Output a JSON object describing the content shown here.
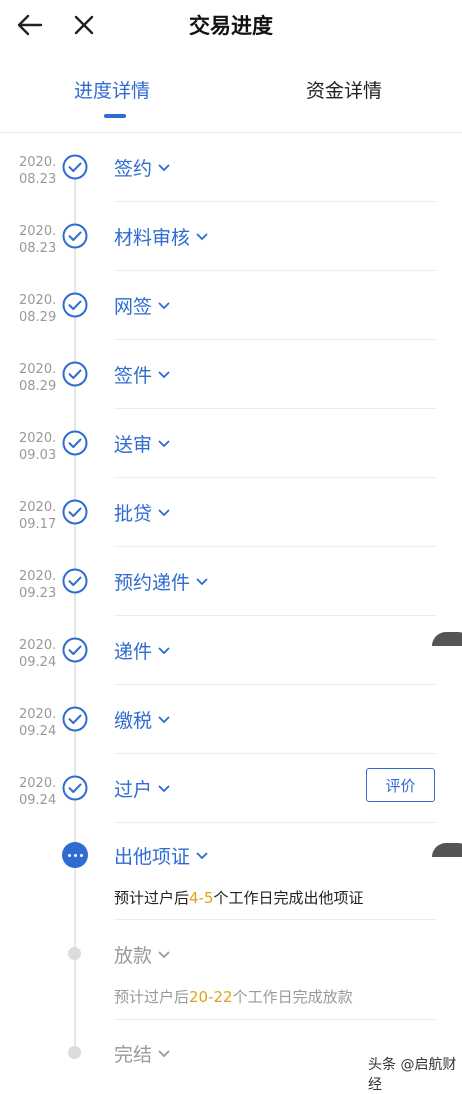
{
  "header": {
    "title": "交易进度"
  },
  "tabs": [
    {
      "label": "进度详情",
      "active": true
    },
    {
      "label": "资金详情",
      "active": false
    }
  ],
  "steps": [
    {
      "date_year": "2020.",
      "date_day": "08.23",
      "label": "签约"
    },
    {
      "date_year": "2020.",
      "date_day": "08.23",
      "label": "材料审核"
    },
    {
      "date_year": "2020.",
      "date_day": "08.29",
      "label": "网签"
    },
    {
      "date_year": "2020.",
      "date_day": "08.29",
      "label": "签件"
    },
    {
      "date_year": "2020.",
      "date_day": "09.03",
      "label": "送审"
    },
    {
      "date_year": "2020.",
      "date_day": "09.17",
      "label": "批贷"
    },
    {
      "date_year": "2020.",
      "date_day": "09.23",
      "label": "预约递件"
    },
    {
      "date_year": "2020.",
      "date_day": "09.24",
      "label": "递件"
    },
    {
      "date_year": "2020.",
      "date_day": "09.24",
      "label": "缴税"
    },
    {
      "date_year": "2020.",
      "date_day": "09.24",
      "label": "过户"
    }
  ],
  "evaluate_label": "评价",
  "current": {
    "label": "出他项证",
    "desc_prefix": "预计过户后",
    "desc_highlight": "4-5",
    "desc_suffix": "个工作日完成出他项证"
  },
  "upcoming": [
    {
      "label": "放款",
      "desc_prefix": "预计过户后",
      "desc_highlight": "20-22",
      "desc_suffix": "个工作日完成放款"
    },
    {
      "label": "完结"
    }
  ],
  "watermark": "头条 @启航财经",
  "colors": {
    "accent": "#2f6bd0",
    "highlight": "#e0a21a",
    "muted": "#9a9a9a"
  }
}
